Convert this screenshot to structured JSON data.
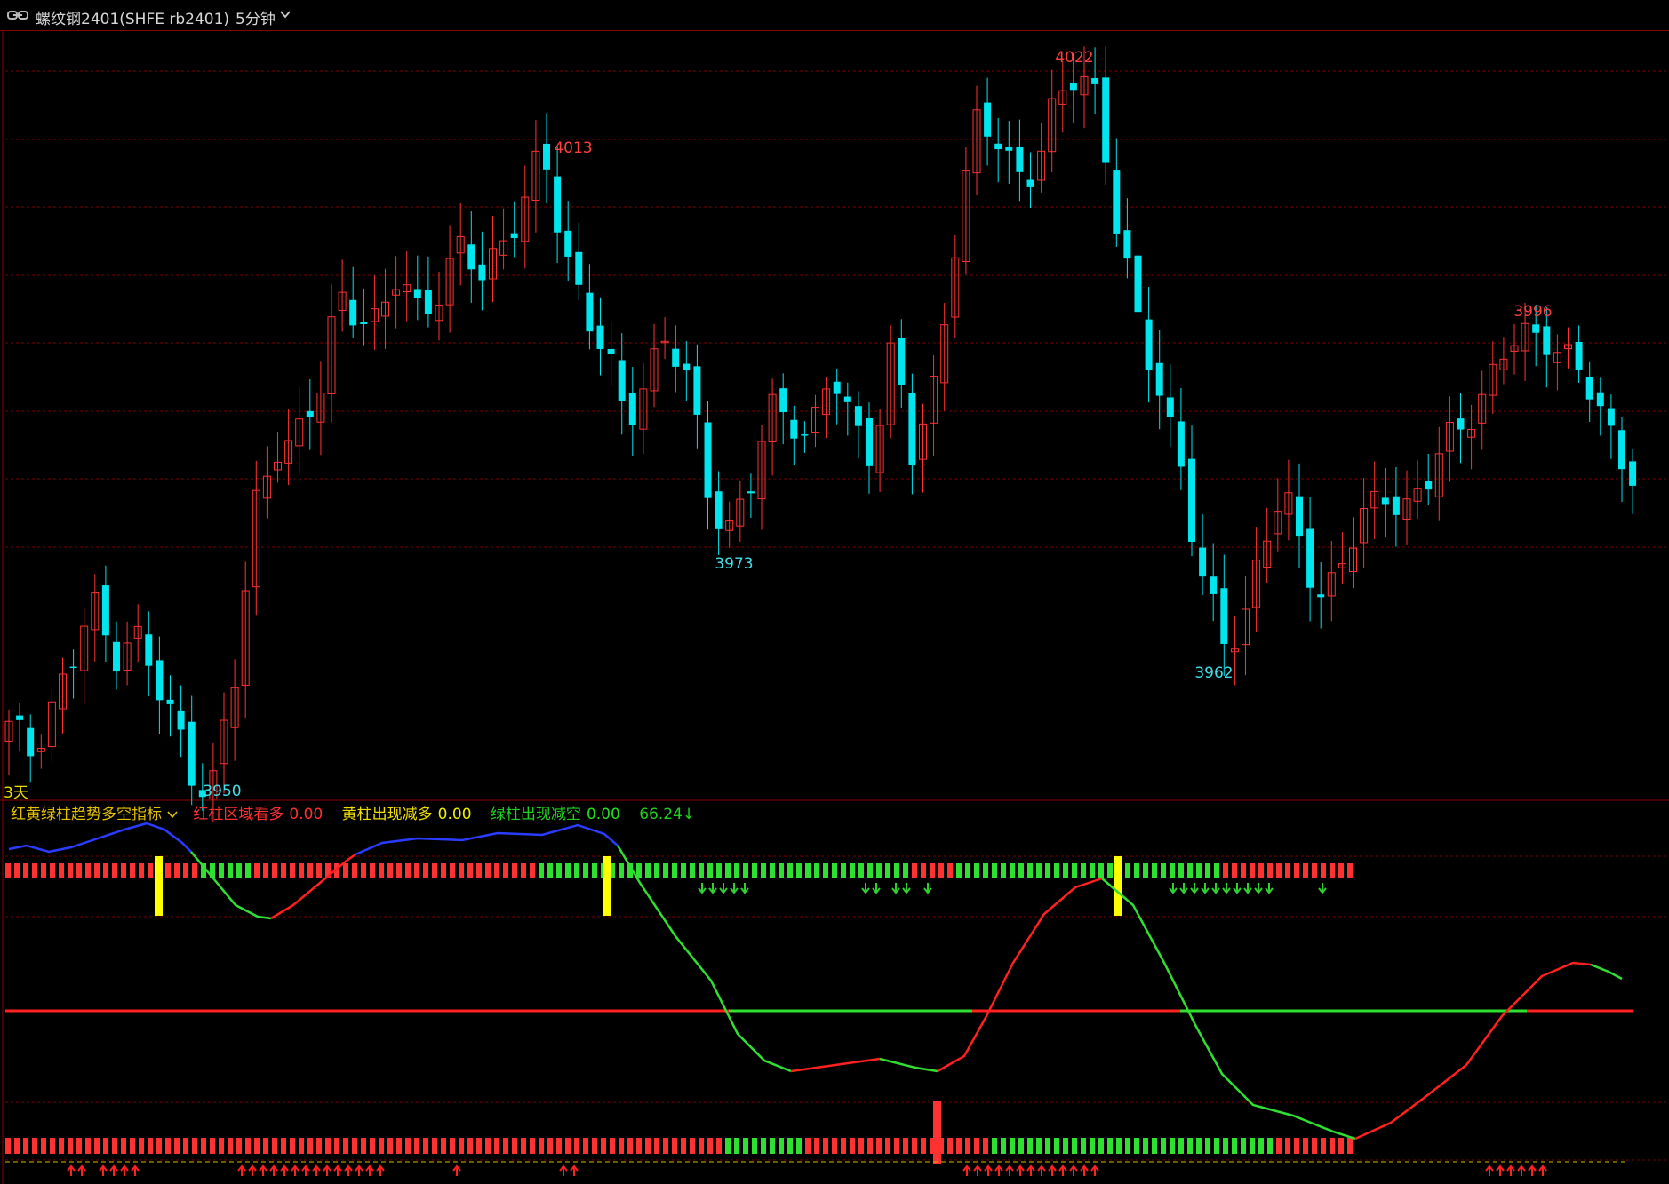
{
  "window": {
    "instrument": "螺纹钢2401(SHFE rb2401)",
    "period": "5分钟"
  },
  "colors": {
    "up": "#ff3232",
    "down": "#00e5ee",
    "grid": "#7a0000",
    "line_blue": "#2a3cff",
    "line_green": "#30e030",
    "line_red": "#ff2020",
    "bar_yellow": "#ffff00",
    "arrow_up": "#ff2020",
    "arrow_down": "#30d030"
  },
  "icons": {
    "link": "link-icon",
    "dropdown": "chevron-down-icon"
  },
  "main_chart": {
    "days_label": "3天",
    "price_labels": [
      {
        "text": "4013",
        "dir": "high"
      },
      {
        "text": "4022",
        "dir": "high"
      },
      {
        "text": "3996",
        "dir": "high"
      },
      {
        "text": "3950",
        "dir": "low"
      },
      {
        "text": "3973",
        "dir": "low"
      },
      {
        "text": "3962",
        "dir": "low"
      }
    ]
  },
  "indicator": {
    "name": "红黄绿柱趋势多空指标",
    "items": [
      {
        "label": "红柱区域看多",
        "value": "0.00"
      },
      {
        "label": "黄柱出现减多",
        "value": "0.00"
      },
      {
        "label": "绿柱出现减空",
        "value": "0.00"
      }
    ],
    "last_value": "66.24↓"
  },
  "chart_data": {
    "type": "candlestick",
    "price_unit": "CNY/ton",
    "ohlc_close_path": [
      3955,
      3953,
      3958,
      3961,
      3968,
      3963,
      3966,
      3960,
      3956,
      3951,
      3950,
      3960,
      3978,
      3985,
      3984,
      3988,
      4000,
      3998,
      3995,
      4002,
      3998,
      4000,
      4003,
      4002,
      4005,
      4008,
      4013,
      4005,
      3998,
      3993,
      3986,
      3992,
      3995,
      3990,
      3980,
      3976,
      3979,
      3987,
      3988,
      3985,
      3991,
      3986,
      3984,
      3994,
      3982,
      3990,
      4005,
      4016,
      4015,
      4012,
      4013,
      4018,
      4022,
      4020,
      4005,
      3995,
      3990,
      3983,
      3970,
      3964,
      3966,
      3975,
      3978,
      3973,
      3969,
      3973,
      3976,
      3980,
      3978,
      3980,
      3984,
      3988,
      3990,
      3994,
      3995,
      3996,
      3992,
      3989,
      3985,
      3982
    ],
    "marked_highs": [
      4013,
      4022,
      3996
    ],
    "marked_lows": [
      3950,
      3973,
      3962
    ],
    "indicator_value": 66.24
  }
}
